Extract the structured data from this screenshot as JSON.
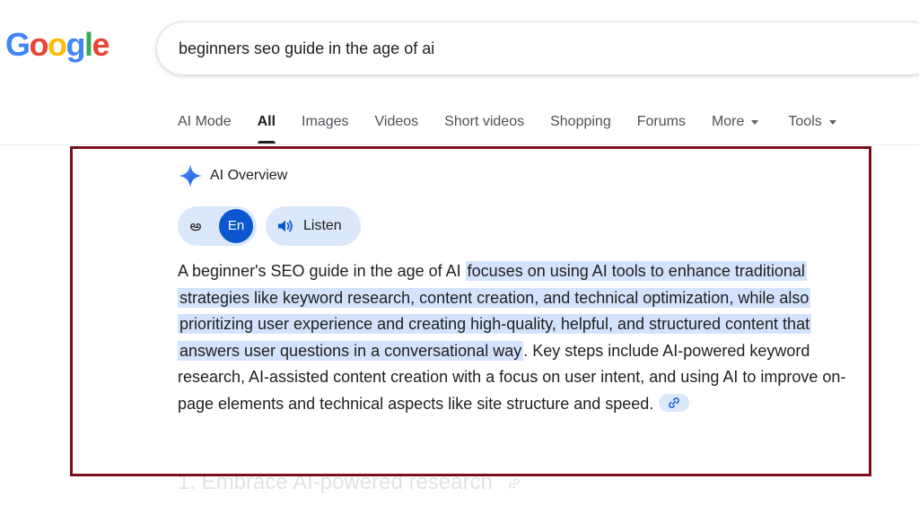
{
  "logo": {
    "letters": [
      "G",
      "o",
      "o",
      "g",
      "l",
      "e"
    ],
    "colors": [
      "#4285F4",
      "#EA4335",
      "#FBBC05",
      "#4285F4",
      "#34A853",
      "#EA4335"
    ]
  },
  "search": {
    "value": "beginners seo guide in the age of ai"
  },
  "tabs": [
    {
      "label": "AI Mode",
      "active": false
    },
    {
      "label": "All",
      "active": true
    },
    {
      "label": "Images",
      "active": false
    },
    {
      "label": "Videos",
      "active": false
    },
    {
      "label": "Short videos",
      "active": false
    },
    {
      "label": "Shopping",
      "active": false
    },
    {
      "label": "Forums",
      "active": false
    },
    {
      "label": "More",
      "active": false
    }
  ],
  "tools": {
    "label": "Tools"
  },
  "ai_overview": {
    "title": "AI Overview",
    "lang_te": "అ",
    "lang_en": "En",
    "listen_label": "Listen",
    "text_lead": "A beginner's SEO guide in the age of AI ",
    "text_highlight": "focuses on using AI tools to enhance traditional strategies like keyword research, content creation, and technical optimization, while also prioritizing user experience and creating high-quality, helpful, and structured content that answers user questions in a conversational way",
    "text_rest": ". Key steps include AI-powered keyword research, AI-assisted content creation with a focus on user intent, and using AI to improve on-page elements and technical aspects like site structure and speed.",
    "next_heading": "1. Embrace AI-powered research"
  },
  "colors": {
    "highlight_bg": "#d3e3fd",
    "frame": "#7b0f1e",
    "accent_blue": "#0b57d0"
  }
}
